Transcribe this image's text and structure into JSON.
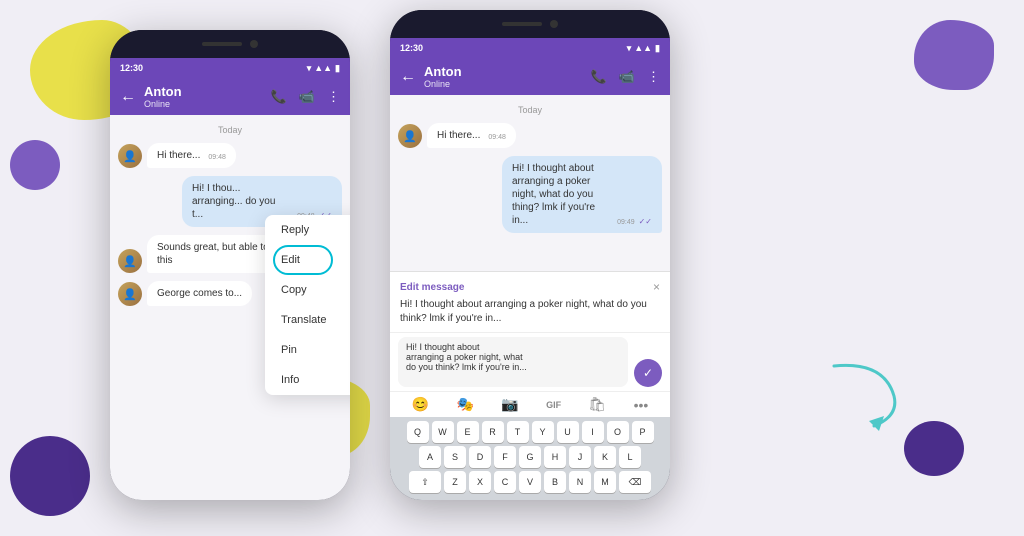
{
  "background_color": "#f0eef5",
  "left_phone": {
    "status_bar": {
      "time": "12:30"
    },
    "header": {
      "back": "←",
      "contact_name": "Anton",
      "contact_status": "Online"
    },
    "chat": {
      "date_label": "Today",
      "messages": [
        {
          "id": "m1",
          "type": "received",
          "text": "Hi there...",
          "time": "09:48",
          "ticks": ""
        },
        {
          "id": "m2",
          "type": "sent",
          "text": "Hi! I thou... arranging... do you t...",
          "time": "09:48",
          "ticks": "✓✓"
        },
        {
          "id": "m3",
          "type": "received",
          "text": "Sounds great, but able to come this",
          "time": "",
          "ticks": ""
        },
        {
          "id": "m4",
          "type": "received",
          "text": "George comes to...",
          "time": "",
          "ticks": ""
        }
      ]
    },
    "context_menu": {
      "items": [
        "Reply",
        "Edit",
        "Copy",
        "Translate",
        "Pin",
        "Info"
      ]
    }
  },
  "right_phone": {
    "status_bar": {
      "time": "12:30"
    },
    "header": {
      "back": "←",
      "contact_name": "Anton",
      "contact_status": "Online"
    },
    "chat": {
      "date_label": "Today",
      "messages": [
        {
          "id": "r1",
          "type": "received",
          "text": "Hi there...",
          "time": "09:48",
          "ticks": ""
        },
        {
          "id": "r2",
          "type": "sent",
          "text": "Hi! I thought about arranging a poker night, what do you thing? lmk if you're in...",
          "time": "09:49",
          "ticks": "✓✓"
        }
      ]
    },
    "edit_bar": {
      "label": "Edit message",
      "close": "×",
      "text": "Hi! I thought about arranging a poker night, what do you think? lmk if you're in..."
    },
    "input": {
      "text": "Hi! I thought about\narranging a poker night, what\ndo you think? lmk if you're in..."
    },
    "keyboard_rows": [
      [
        "Q",
        "W",
        "E",
        "R",
        "T",
        "Y",
        "U",
        "I",
        "O",
        "P"
      ],
      [
        "A",
        "S",
        "D",
        "F",
        "G",
        "H",
        "J",
        "K",
        "L"
      ],
      [
        "Z",
        "X",
        "C",
        "V",
        "B",
        "N",
        "M"
      ]
    ]
  }
}
